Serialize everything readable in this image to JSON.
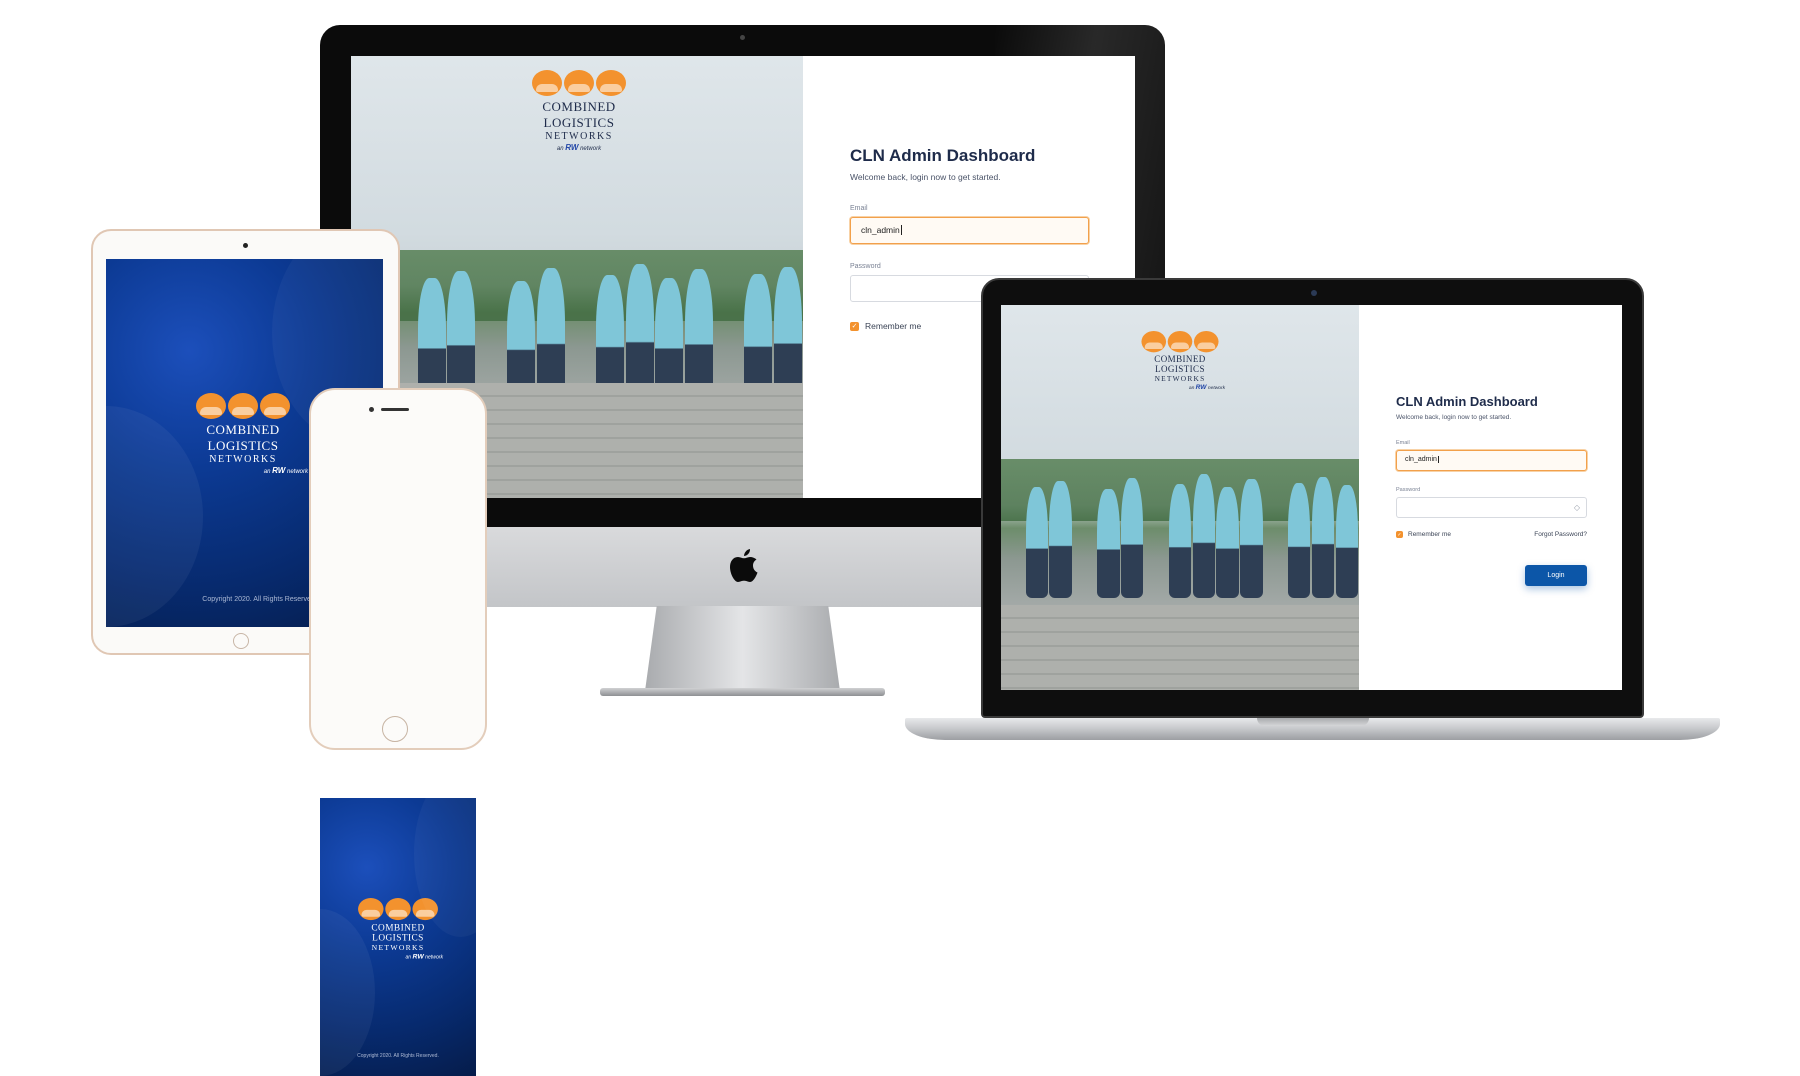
{
  "brand": {
    "logo_line1": "COMBINED LOGISTICS",
    "logo_line2": "NETWORKS",
    "logo_sub_prefix": "an",
    "logo_sub_brand": "RW",
    "logo_sub_suffix": "network"
  },
  "login": {
    "title": "CLN Admin Dashboard",
    "welcome": "Welcome back, login now to get started.",
    "email_label": "Email",
    "email_value": "cln_admin",
    "password_label": "Password",
    "password_value": "",
    "remember_label": "Remember me",
    "forgot_label": "Forgot Password?",
    "login_button": "Login"
  },
  "splash": {
    "copyright": "Copyright 2020. All Rights Reserved."
  },
  "colors": {
    "accent_orange": "#f3922e",
    "brand_blue": "#0c56a8",
    "splash_navy": "#072a6e"
  },
  "icons": {
    "apple": "apple-logo",
    "check": "checkmark-icon",
    "eye": "eye-icon"
  }
}
